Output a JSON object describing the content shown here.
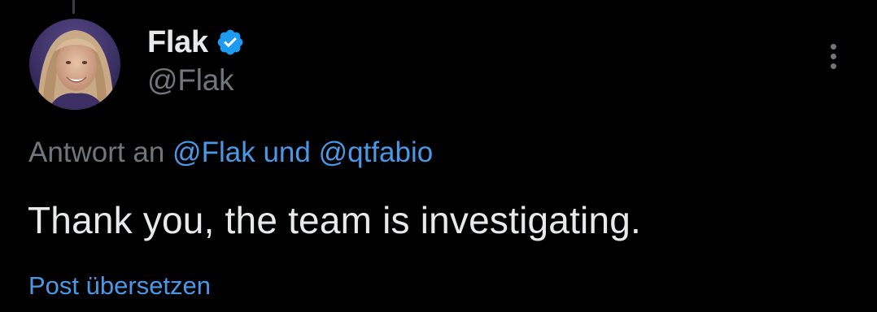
{
  "tweet": {
    "author": {
      "display_name": "Flak",
      "handle": "@Flak",
      "verified": true,
      "avatar_icon": "avatar-photo",
      "verified_icon": "verified-badge-icon"
    },
    "reply_context": {
      "prefix": "Antwort an",
      "mentions": [
        "@Flak",
        "@qtfabio"
      ],
      "joiner": "und"
    },
    "text": "Thank you, the team is investigating.",
    "translate_label": "Post übersetzen",
    "more_icon": "more-vertical-icon"
  },
  "colors": {
    "background": "#000000",
    "primary_text": "#e7e9ea",
    "secondary_text": "#71767b",
    "link": "#4a99e9",
    "verified": "#1d9bf0"
  }
}
